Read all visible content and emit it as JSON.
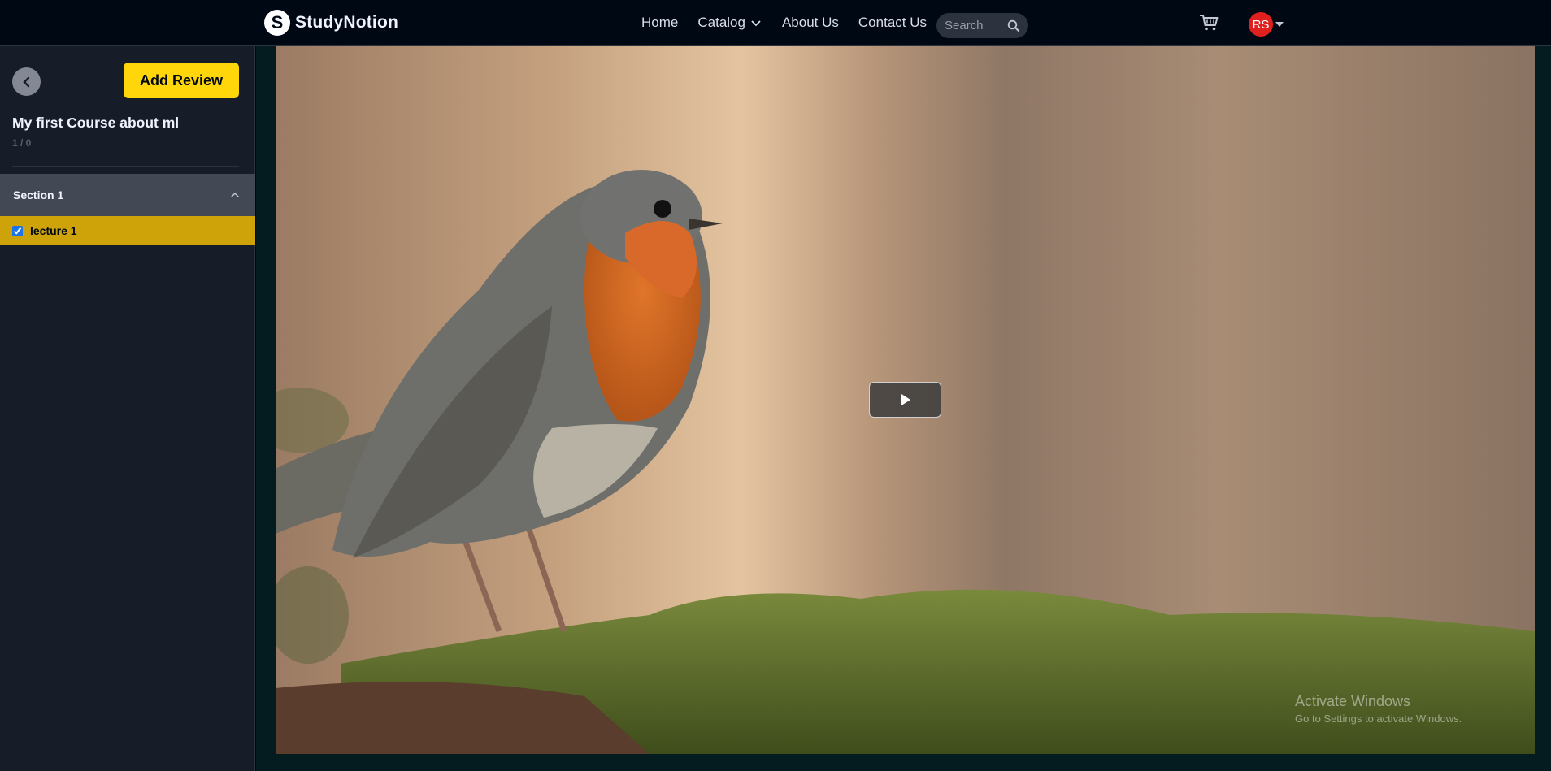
{
  "brand": {
    "name": "StudyNotion",
    "mark": "S"
  },
  "nav": {
    "links": [
      {
        "label": "Home"
      },
      {
        "label": "Catalog"
      },
      {
        "label": "About Us"
      },
      {
        "label": "Contact Us"
      }
    ],
    "search_placeholder": "Search",
    "cart_icon": "cart-icon",
    "avatar_initials": "RS"
  },
  "sidebar": {
    "add_review_label": "Add Review",
    "course_title": "My first Course about ml",
    "progress": "1 / 0",
    "sections": [
      {
        "title": "Section 1",
        "expanded": true,
        "lectures": [
          {
            "title": "lecture 1",
            "completed": true
          }
        ]
      }
    ]
  },
  "video": {
    "state": "paused",
    "play_icon": "play-icon"
  },
  "watermark": {
    "title": "Activate Windows",
    "subtitle": "Go to Settings to activate Windows."
  },
  "colors": {
    "background": "#000814",
    "sidebar": "#161d29",
    "accent": "#ffd60a",
    "active_lecture": "#cea309",
    "section_header": "#424854",
    "avatar": "#e0201f"
  }
}
